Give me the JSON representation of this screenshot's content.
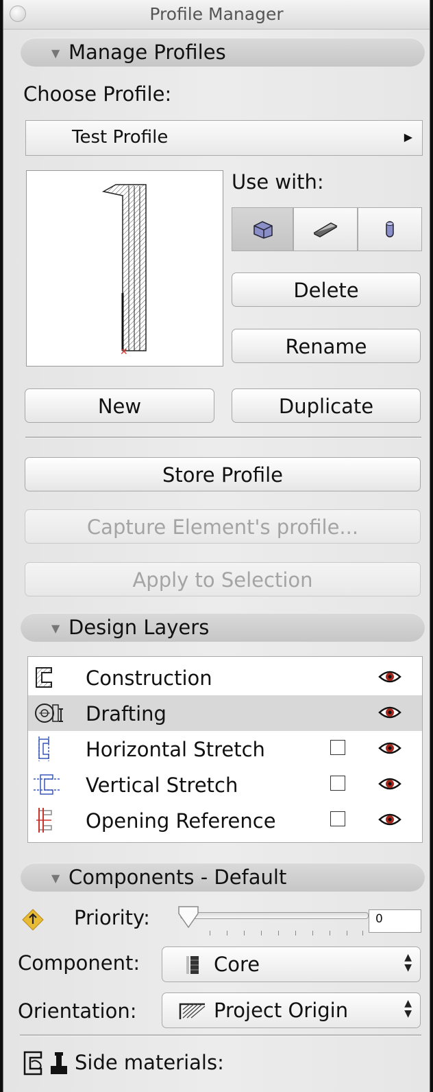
{
  "window": {
    "title": "Profile Manager"
  },
  "manage_profiles": {
    "header": "Manage Profiles",
    "choose_label": "Choose Profile:",
    "selected_profile": "Test Profile",
    "use_with_label": "Use with:",
    "use_with_buttons": [
      {
        "icon": "wall-icon",
        "active": true
      },
      {
        "icon": "beam-icon",
        "active": false
      },
      {
        "icon": "column-icon",
        "active": false
      }
    ],
    "buttons": {
      "delete": "Delete",
      "rename": "Rename",
      "new": "New",
      "duplicate": "Duplicate",
      "store": "Store Profile",
      "capture": "Capture Element's profile...",
      "apply": "Apply to Selection"
    }
  },
  "design_layers": {
    "header": "Design Layers",
    "items": [
      {
        "name": "Construction",
        "icon": "construction-layer-icon",
        "has_checkbox": false,
        "selected": false,
        "visible": true
      },
      {
        "name": "Drafting",
        "icon": "drafting-layer-icon",
        "has_checkbox": false,
        "selected": true,
        "visible": true
      },
      {
        "name": "Horizontal Stretch",
        "icon": "horizontal-stretch-icon",
        "has_checkbox": true,
        "selected": false,
        "visible": true
      },
      {
        "name": "Vertical Stretch",
        "icon": "vertical-stretch-icon",
        "has_checkbox": true,
        "selected": false,
        "visible": true
      },
      {
        "name": "Opening Reference",
        "icon": "opening-reference-icon",
        "has_checkbox": true,
        "selected": false,
        "visible": true
      }
    ]
  },
  "components": {
    "header": "Components - Default",
    "priority_label": "Priority:",
    "priority_value": "0",
    "component_label": "Component:",
    "component_value": "Core",
    "orientation_label": "Orientation:",
    "orientation_value": "Project Origin",
    "side_materials_label": "Side materials:"
  },
  "colors": {
    "eye_red": "#a4271c",
    "stretch_blue": "#3a57b8",
    "opening_red": "#c8332b",
    "priority_diamond": "#e7bb33"
  }
}
